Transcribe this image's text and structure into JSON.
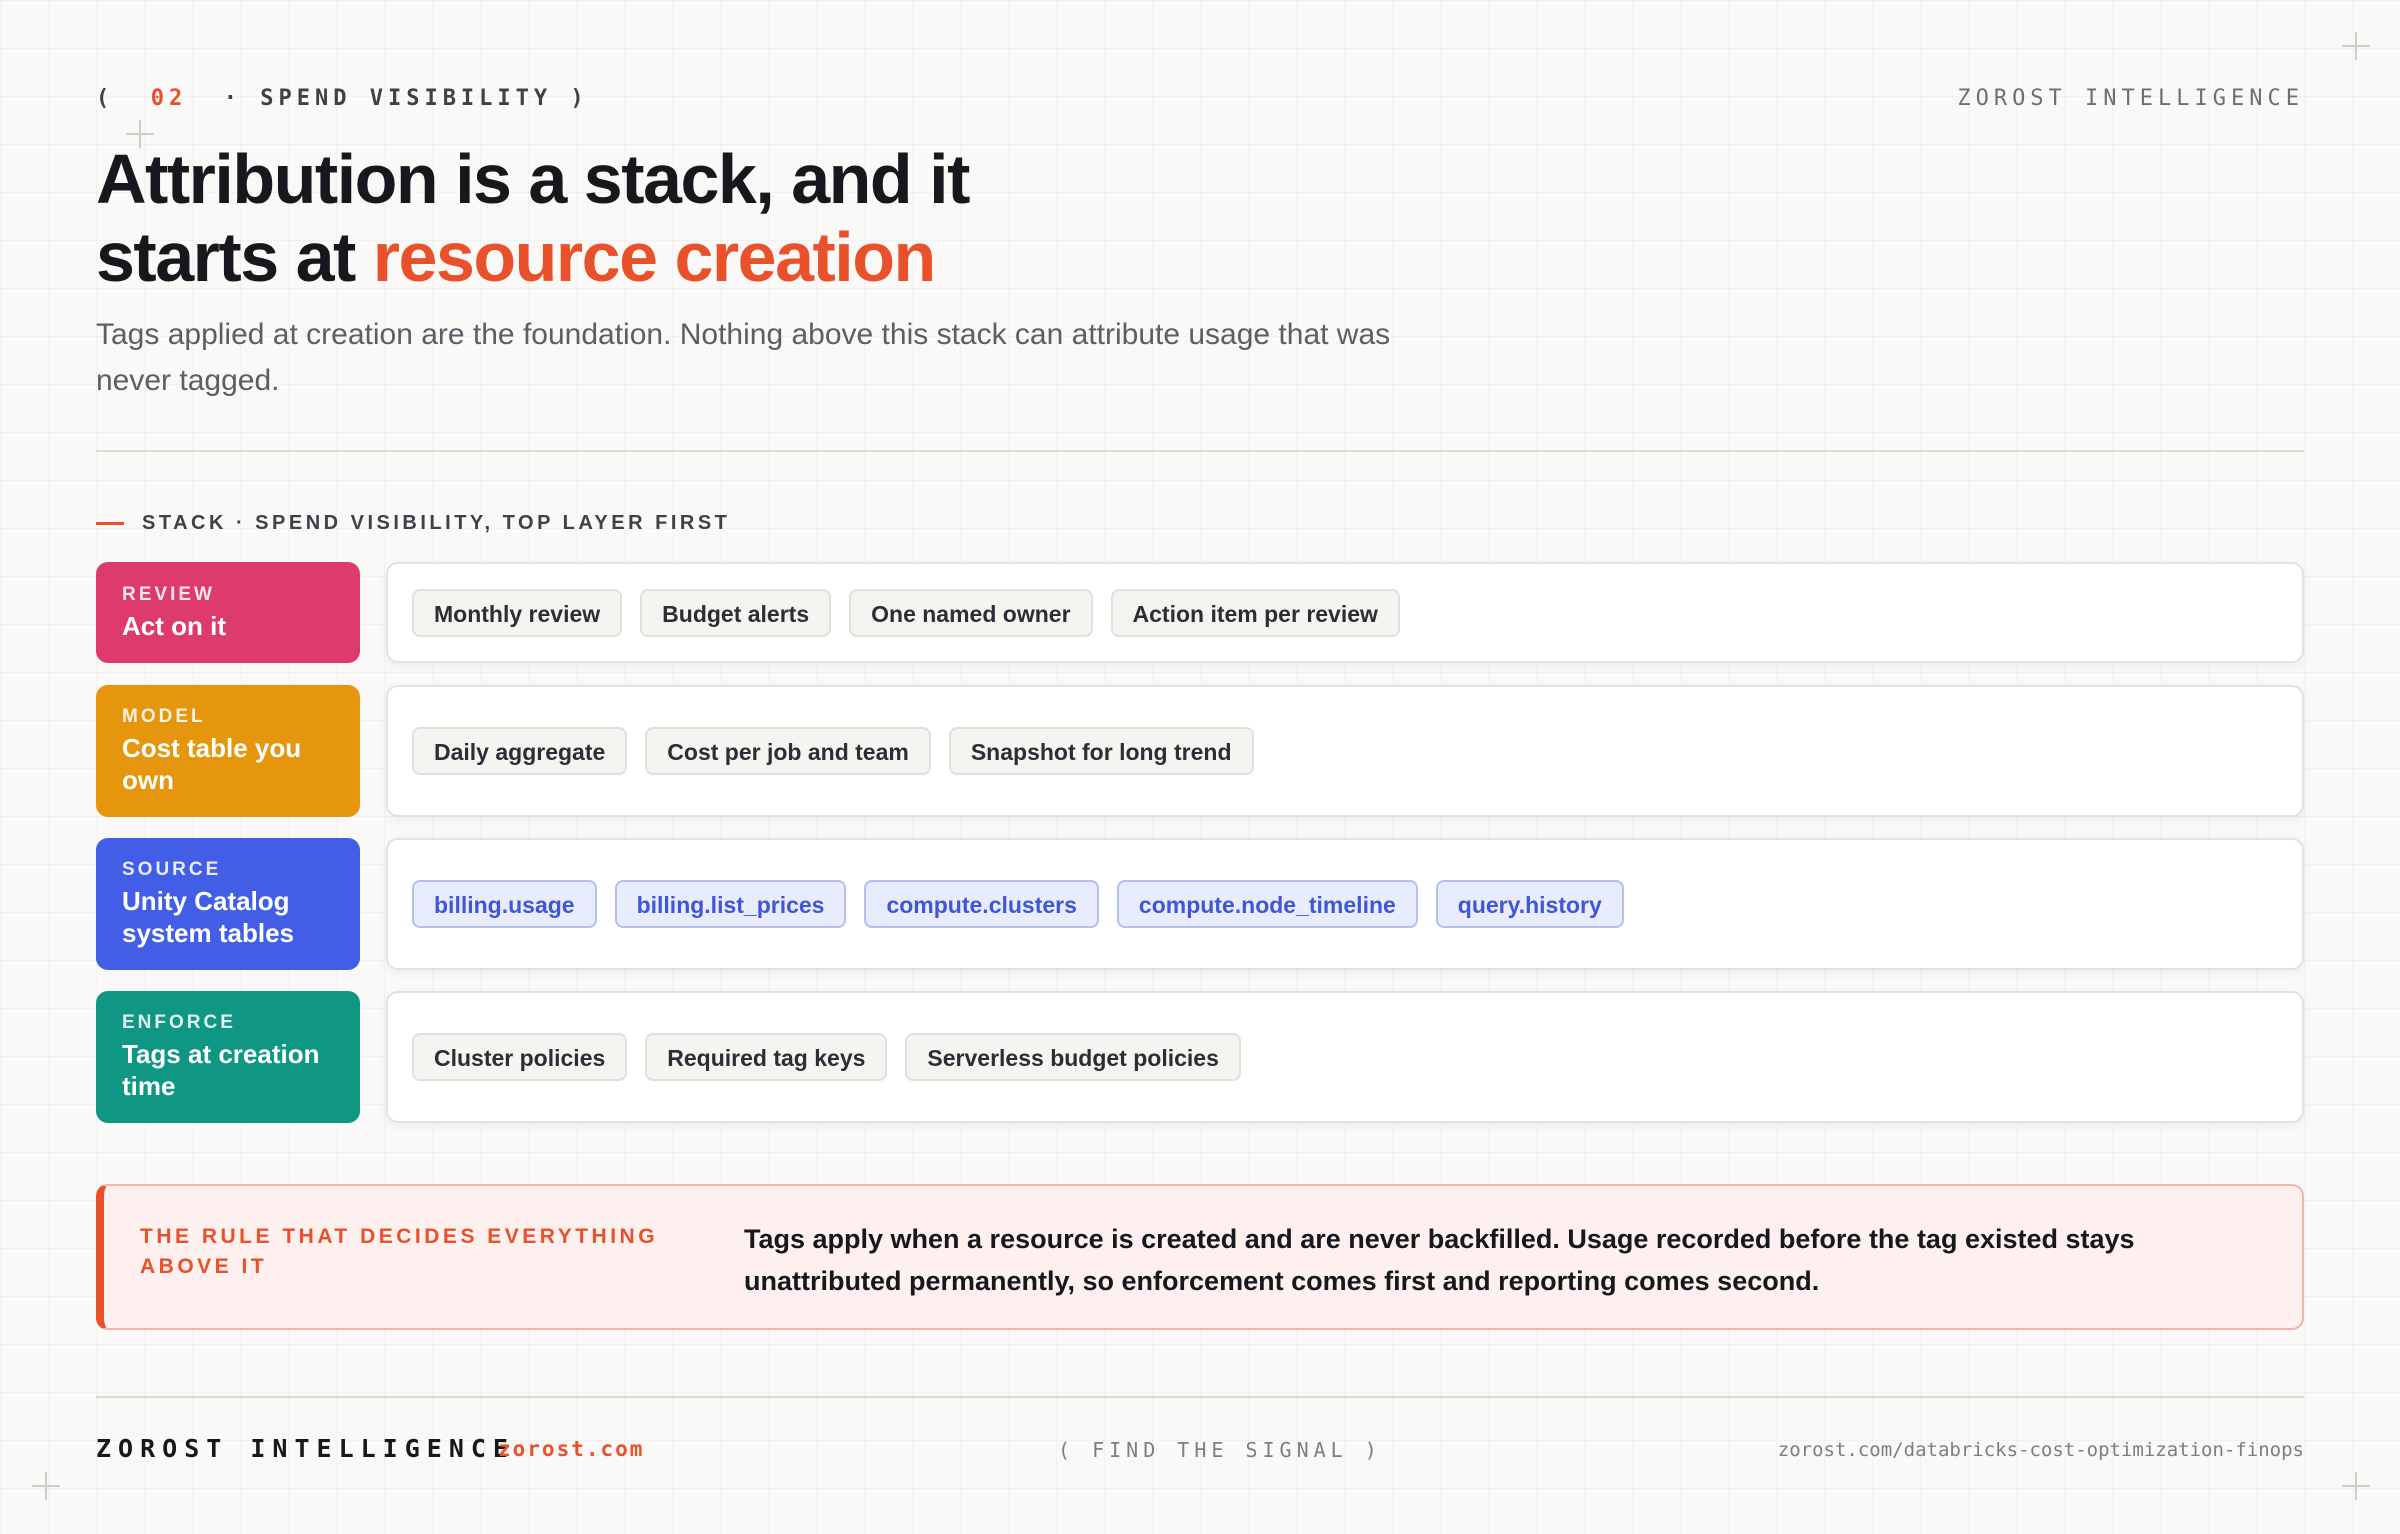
{
  "header": {
    "eyebrow_open": "(",
    "eyebrow_num": "02",
    "eyebrow_text": "· SPEND VISIBILITY )",
    "brand": "ZOROST INTELLIGENCE"
  },
  "title": {
    "line1": "Attribution is a stack, and it",
    "line2_prefix": "starts at ",
    "line2_accent": "resource creation"
  },
  "subtitle": "Tags applied at creation are the foundation. Nothing above this stack can attribute usage that was never tagged.",
  "stack": {
    "label": "STACK · SPEND VISIBILITY, TOP LAYER FIRST",
    "layers": [
      {
        "kicker": "REVIEW",
        "title": "Act on it",
        "color": "#dd3a6e",
        "chips": [
          "Monthly review",
          "Budget alerts",
          "One named owner",
          "Action item per review"
        ]
      },
      {
        "kicker": "MODEL",
        "title": "Cost table you own",
        "color": "#e6960d",
        "chips": [
          "Daily aggregate",
          "Cost per job and team",
          "Snapshot for long trend"
        ]
      },
      {
        "kicker": "SOURCE",
        "title": "Unity Catalog system tables",
        "color": "#435ee6",
        "chips": [
          "billing.usage",
          "billing.list_prices",
          "compute.clusters",
          "compute.node_timeline",
          "query.history"
        ]
      },
      {
        "kicker": "ENFORCE",
        "title": "Tags at creation time",
        "color": "#0f9784",
        "chips": [
          "Cluster policies",
          "Required tag keys",
          "Serverless budget policies"
        ]
      }
    ]
  },
  "callout": {
    "label": "THE RULE THAT DECIDES EVERYTHING ABOVE IT",
    "text": "Tags apply when a resource is created and are never backfilled. Usage recorded before the tag existed stays unattributed permanently, so enforcement comes first and reporting comes second."
  },
  "footer": {
    "brand": "ZOROST INTELLIGENCE",
    "site": "zorost.com",
    "signal": "( FIND THE SIGNAL )",
    "url": "zorost.com/databricks-cost-optimization-finops"
  },
  "colors": {
    "accent": "#e8512a",
    "code_chip": "#3f56d6"
  }
}
